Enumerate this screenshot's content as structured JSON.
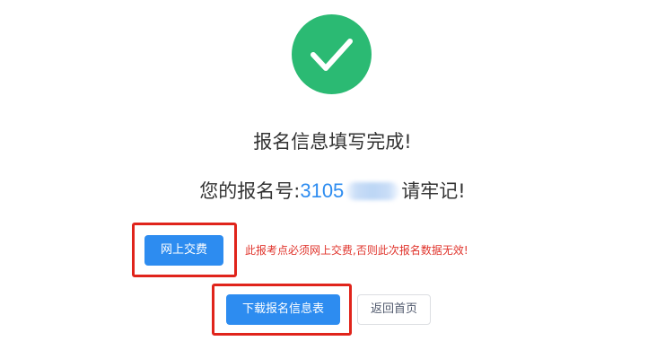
{
  "success": {
    "icon": "checkmark-icon",
    "color": "#2bba73",
    "title": "报名信息填写完成!"
  },
  "registration": {
    "prefix": "您的报名号:",
    "number": "3105",
    "suffix": "请牢记!"
  },
  "payment": {
    "button_label": "网上交费",
    "notice": "此报考点必须网上交费,否则此次报名数据无效!"
  },
  "actions": {
    "download_label": "下载报名信息表",
    "home_label": "返回首页"
  },
  "colors": {
    "primary": "#2d8cf0",
    "highlight": "#e0241b",
    "warning": "#e0332b"
  }
}
